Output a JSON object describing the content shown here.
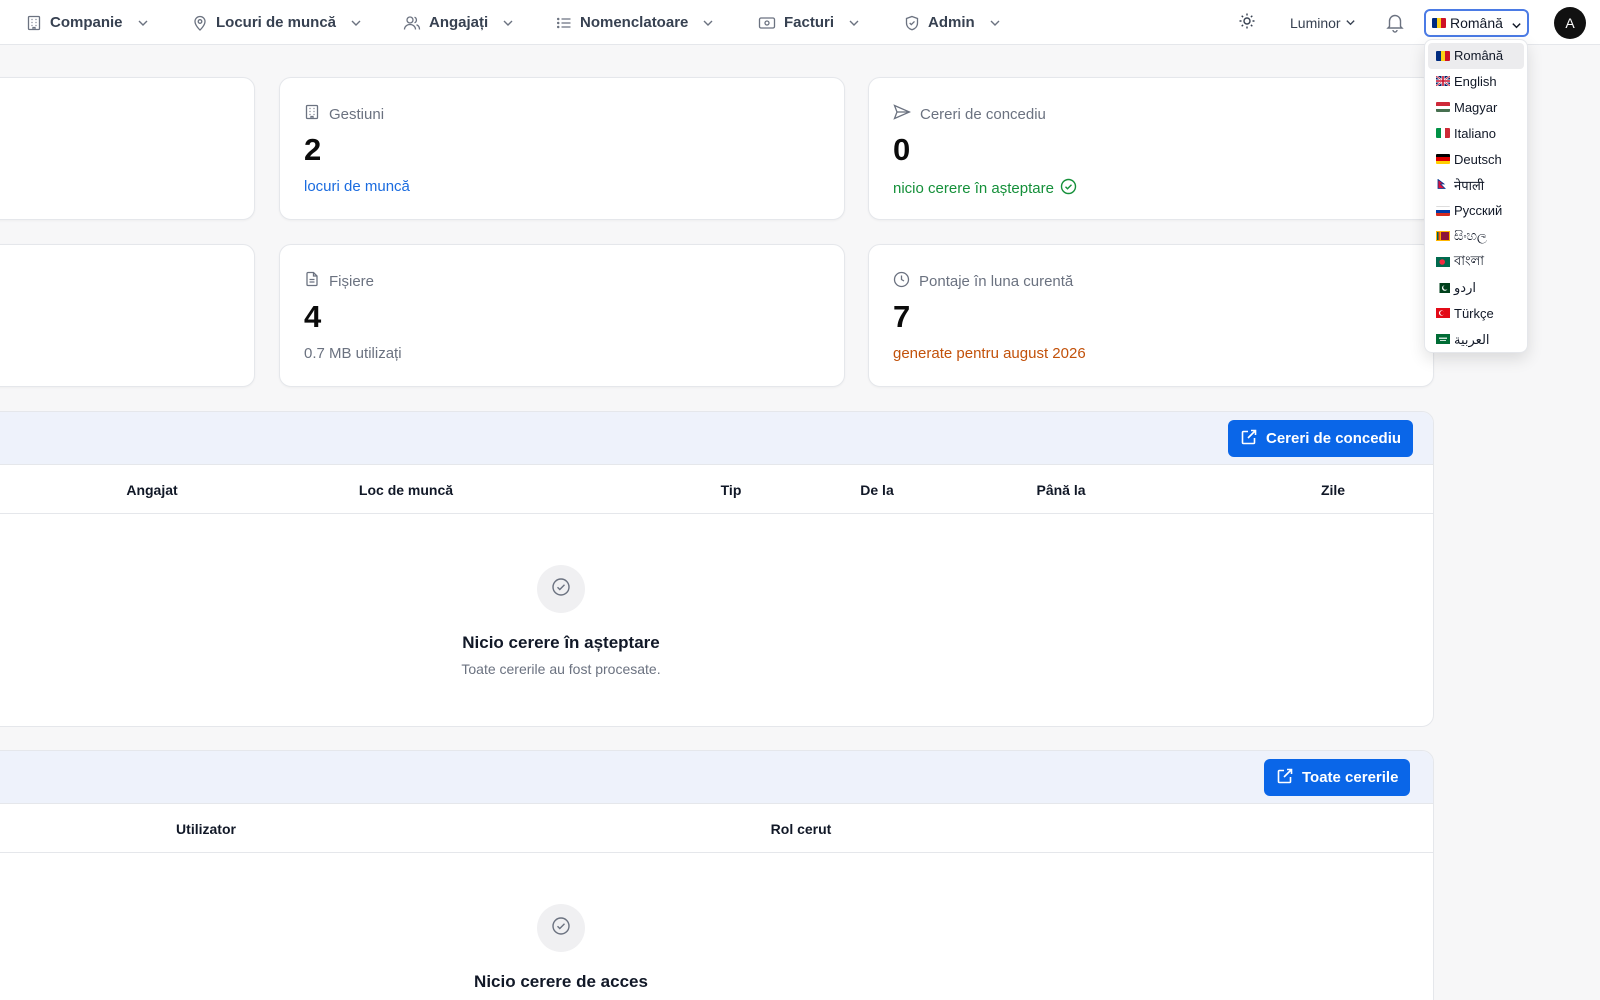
{
  "nav": {
    "items": [
      {
        "label": "Companie",
        "icon": "building-icon"
      },
      {
        "label": "Locuri de muncă",
        "icon": "map-pin-icon"
      },
      {
        "label": "Angajați",
        "icon": "users-icon"
      },
      {
        "label": "Nomenclatoare",
        "icon": "list-icon"
      },
      {
        "label": "Facturi",
        "icon": "banknote-icon"
      },
      {
        "label": "Admin",
        "icon": "shield-icon"
      }
    ],
    "theme_icon": "sun-icon",
    "theme_label": "Luminor",
    "notifications_icon": "bell-icon",
    "language_selected": "Română",
    "avatar_initial": "A"
  },
  "stats": {
    "gestiuni": {
      "label": "Gestiuni",
      "value": "2",
      "sub": "locuri de muncă",
      "color": "#1a6bdf"
    },
    "cereri": {
      "label": "Cereri de concediu",
      "value": "0",
      "sub": "nicio cerere în așteptare",
      "color": "#15903a"
    },
    "fisiere": {
      "label": "Fișiere",
      "value": "4",
      "sub": "0.7 MB utilizați",
      "color": "#6b7280"
    },
    "pontaje": {
      "label": "Pontaje în luna curentă",
      "value": "7",
      "sub": "generate pentru august 2026",
      "color": "#c2510a"
    }
  },
  "leave_panel": {
    "button_label": "Cereri de concediu",
    "columns": [
      "Angajat",
      "Loc de muncă",
      "Tip",
      "De la",
      "Până la",
      "Zile"
    ],
    "empty_title": "Nicio cerere în așteptare",
    "empty_desc": "Toate cererile au fost procesate."
  },
  "access_panel": {
    "button_label": "Toate cererile",
    "columns": [
      "Utilizator",
      "Rol cerut"
    ],
    "empty_title": "Nicio cerere de acces"
  },
  "languages": [
    "Română",
    "English",
    "Magyar",
    "Italiano",
    "Deutsch",
    "नेपाली",
    "Русский",
    "සිංහල",
    "বাংলা",
    "اردو",
    "Türkçe",
    "العربية"
  ],
  "colors": {
    "accent": "#0a66e8",
    "focus": "#4b7be5"
  }
}
